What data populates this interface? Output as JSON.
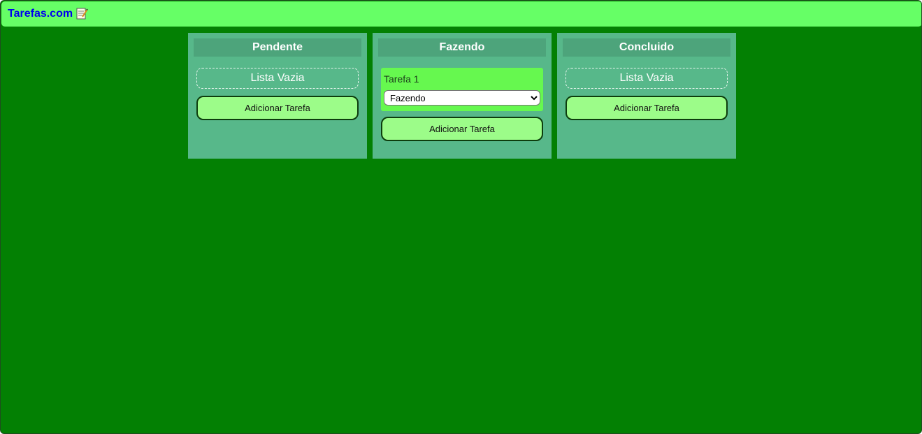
{
  "header": {
    "brand": "Tarefas.com",
    "icon": "memo-icon"
  },
  "colors": {
    "background": "#038003",
    "header": "#66ff66",
    "column": "#57b88a",
    "column_title": "#4da47b",
    "task_card": "#66f84f",
    "button": "#9cfc89",
    "brand_link": "#0000ee"
  },
  "columns": [
    {
      "title": "Pendente",
      "empty_text": "Lista Vazia",
      "add_label": "Adicionar Tarefa"
    },
    {
      "title": "Fazendo",
      "tasks": [
        {
          "name": "Tarefa 1",
          "status": "Fazendo"
        }
      ],
      "add_label": "Adicionar Tarefa"
    },
    {
      "title": "Concluido",
      "empty_text": "Lista Vazia",
      "add_label": "Adicionar Tarefa"
    }
  ]
}
